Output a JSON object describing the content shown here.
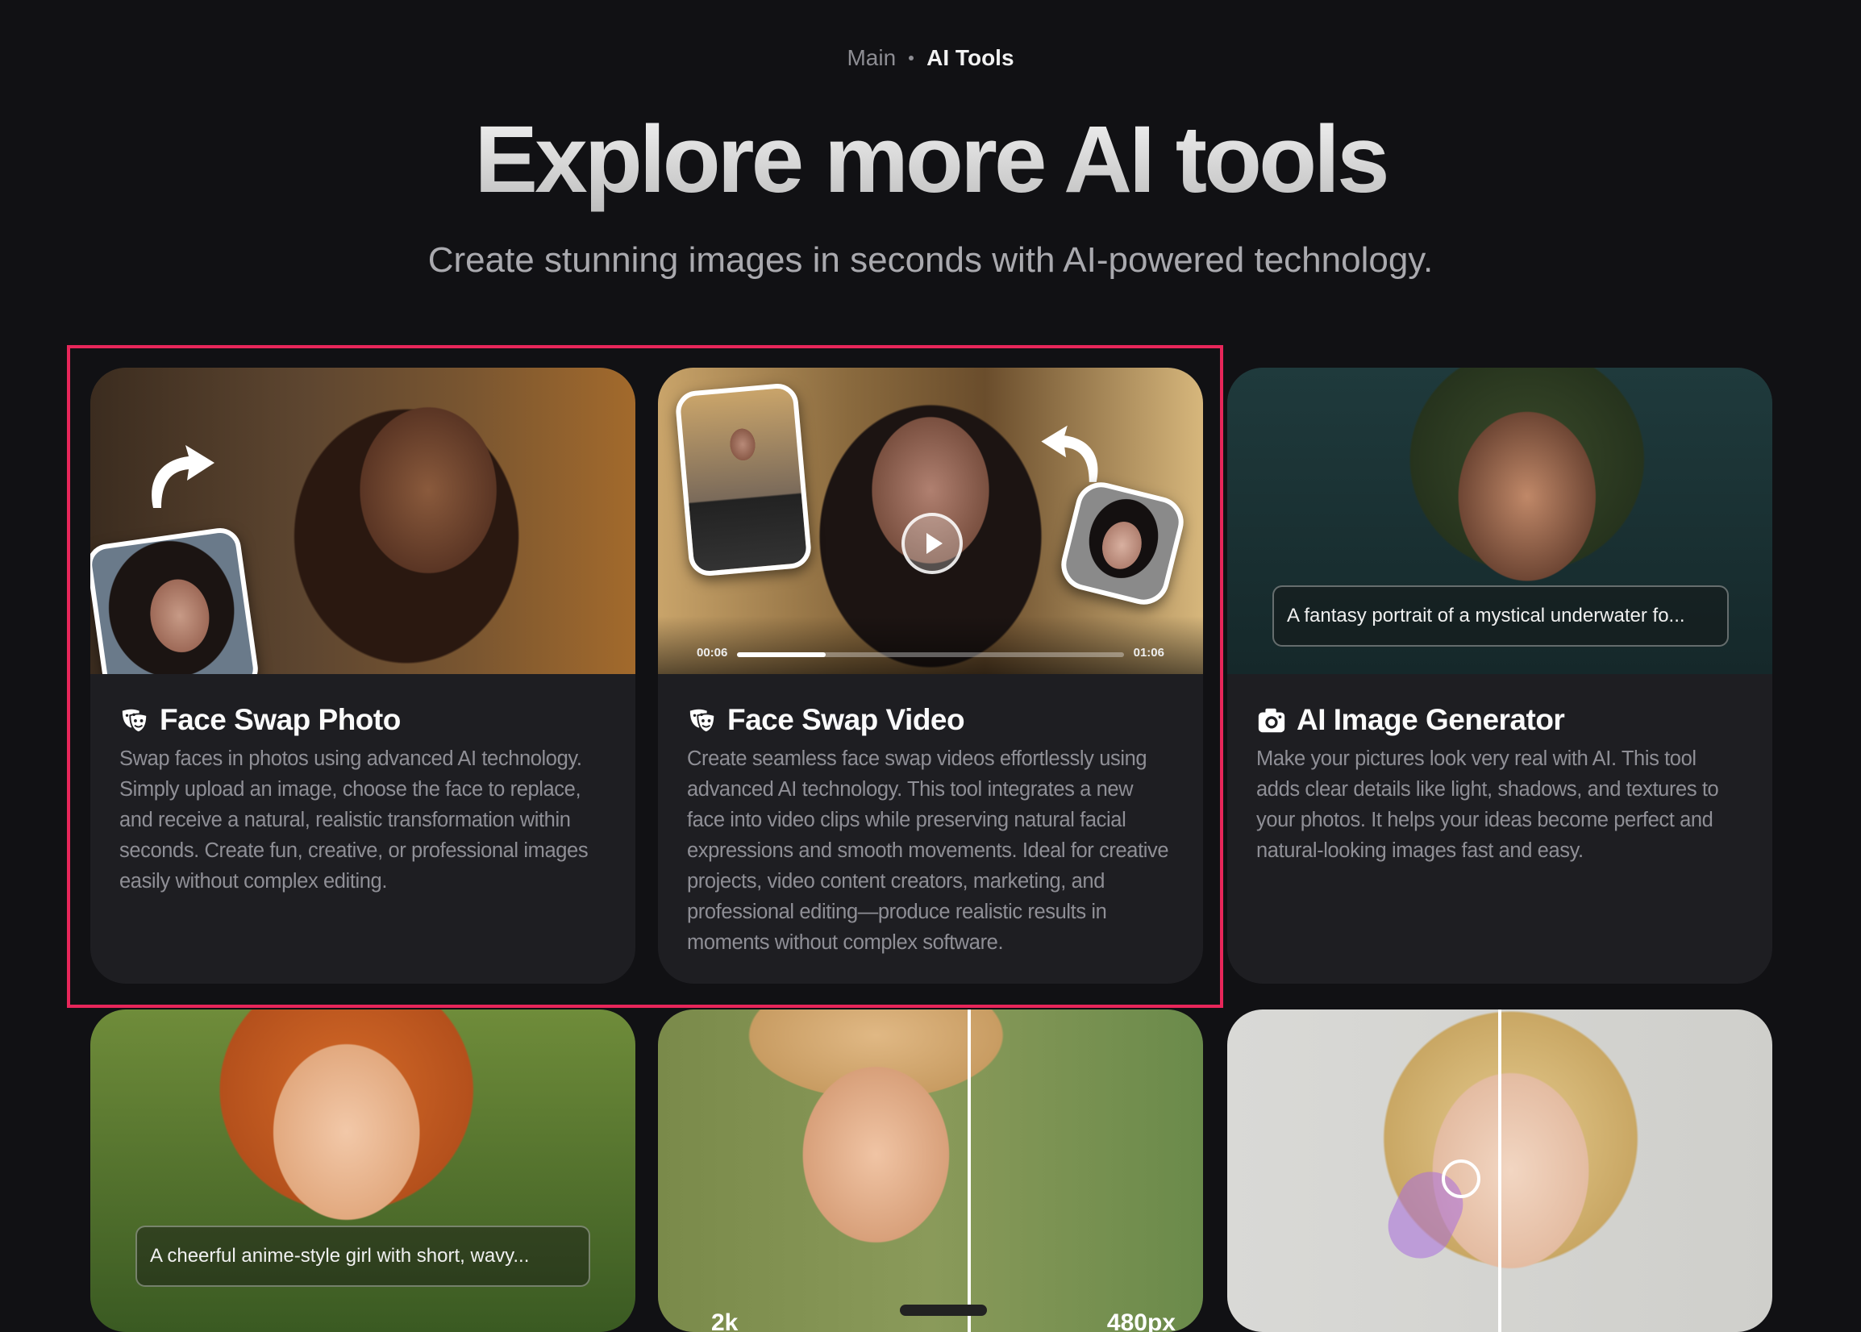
{
  "breadcrumb": {
    "main": "Main",
    "current": "AI Tools"
  },
  "hero": {
    "title": "Explore more AI tools",
    "subtitle": "Create stunning images in seconds with AI-powered technology."
  },
  "cards": [
    {
      "icon": "theater-masks-icon",
      "title": "Face Swap Photo",
      "description": "Swap faces in photos using advanced AI technology. Simply upload an image, choose the face to replace, and receive a natural, realistic transformation within seconds. Create fun, creative, or professional images easily without complex editing."
    },
    {
      "icon": "theater-masks-icon",
      "title": "Face Swap Video",
      "description": "Create seamless face swap videos effortlessly using advanced AI technology. This tool integrates a new face into video clips while preserving natural facial expressions and smooth movements. Ideal for creative projects, video content creators, marketing, and professional editing—produce realistic results in moments without complex software.",
      "video": {
        "current_time": "00:06",
        "duration": "01:06",
        "progress": 0.23
      }
    },
    {
      "icon": "camera-icon",
      "title": "AI Image Generator",
      "description": "Make your pictures look very real with AI. This tool adds clear details like light, shadows, and textures to your photos. It helps your ideas become perfect and natural-looking images fast and easy.",
      "prompt": "A fantasy portrait of a mystical underwater fo..."
    },
    {
      "prompt": "A cheerful anime-style girl with short, wavy..."
    },
    {
      "label_left": "2k",
      "label_right": "480px"
    },
    {}
  ],
  "colors": {
    "background": "#111114",
    "card": "#1e1e22",
    "highlight": "#e8265a"
  }
}
